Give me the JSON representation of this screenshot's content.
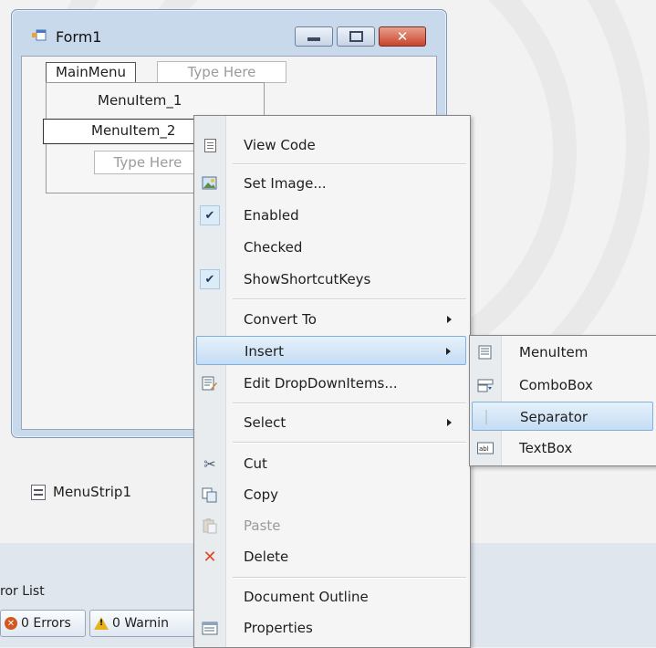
{
  "form": {
    "title": "Form1",
    "menu_bar": {
      "main_item": "MainMenu",
      "type_here": "Type Here"
    },
    "dropdown": {
      "item1": "MenuItem_1",
      "item2": "MenuItem_2",
      "type_here": "Type Here"
    }
  },
  "tray": {
    "component": "MenuStrip1"
  },
  "error_list": {
    "title": "ror List",
    "errors": "0 Errors",
    "warnings": "0 Warnin"
  },
  "context_menu": {
    "items": [
      {
        "label": "View Code",
        "icon": "view-code-icon"
      },
      {
        "label": "Set Image...",
        "icon": "image-icon"
      },
      {
        "label": "Enabled",
        "checked": true
      },
      {
        "label": "Checked",
        "checked": false
      },
      {
        "label": "ShowShortcutKeys",
        "checked": true
      },
      {
        "label": "Convert To",
        "submenu": true
      },
      {
        "label": "Insert",
        "submenu": true,
        "highlighted": true
      },
      {
        "label": "Edit DropDownItems...",
        "icon": "edit-items-icon"
      },
      {
        "label": "Select",
        "submenu": true
      },
      {
        "label": "Cut",
        "icon": "scissors-icon"
      },
      {
        "label": "Copy",
        "icon": "copy-icon"
      },
      {
        "label": "Paste",
        "icon": "paste-icon",
        "disabled": true
      },
      {
        "label": "Delete",
        "icon": "delete-icon"
      },
      {
        "label": "Document Outline"
      },
      {
        "label": "Properties",
        "icon": "properties-icon"
      }
    ]
  },
  "insert_submenu": {
    "items": [
      {
        "label": "MenuItem",
        "icon": "menuitem-icon"
      },
      {
        "label": "ComboBox",
        "icon": "combobox-icon"
      },
      {
        "label": "Separator",
        "icon": "separator-icon",
        "highlighted": true
      },
      {
        "label": "TextBox",
        "icon": "textbox-icon"
      }
    ]
  },
  "colors": {
    "highlight": "#c4dcf3",
    "close_button": "#c8452c",
    "window_frame": "#c9d9ec"
  }
}
